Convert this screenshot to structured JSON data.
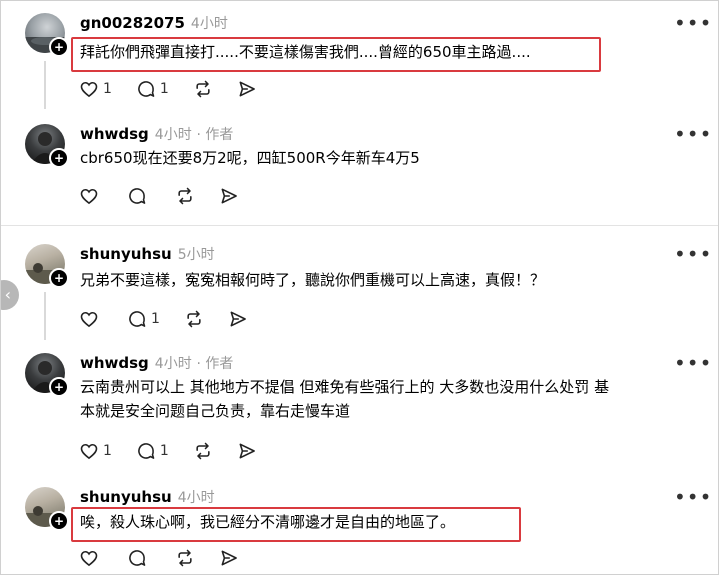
{
  "posts": [
    {
      "username": "gn00282075",
      "time": "4小时",
      "author_tag": "",
      "text_lines": [
        "拜託你們飛彈直接打.....不要這樣傷害我們....曾經的650車主路過...."
      ],
      "likes": "1",
      "replies": "1",
      "highlighted": true
    },
    {
      "username": "whwdsg",
      "time": "4小时",
      "author_tag": "· 作者",
      "text_lines": [
        "cbr650现在还要8万2呢，四缸500R今年新车4万5"
      ],
      "likes": "",
      "replies": "",
      "highlighted": false
    },
    {
      "username": "shunyuhsu",
      "time": "5小时",
      "author_tag": "",
      "text_lines": [
        "兄弟不要這樣，寃寃相報何時了，聽說你們重機可以上高速，真假！？"
      ],
      "likes": "",
      "replies": "1",
      "highlighted": false
    },
    {
      "username": "whwdsg",
      "time": "4小时",
      "author_tag": "· 作者",
      "text_lines": [
        "云南贵州可以上 其他地方不提倡 但难免有些强行上的 大多数也没用什么处罚 基",
        "本就是安全问题自己负责，靠右走慢车道"
      ],
      "likes": "1",
      "replies": "1",
      "highlighted": false
    },
    {
      "username": "shunyuhsu",
      "time": "4小时",
      "author_tag": "",
      "text_lines": [
        "唉，殺人珠心啊，我已經分不清哪邊才是自由的地區了。"
      ],
      "likes": "",
      "replies": "",
      "highlighted": true
    }
  ],
  "icons": {
    "like": "heart-icon",
    "reply": "comment-icon",
    "repost": "repost-icon",
    "share": "send-icon",
    "more": "more-icon",
    "follow": "plus-icon",
    "back": "chevron-left-icon"
  },
  "symbols": {
    "more": "•••",
    "plus": "+",
    "back": "‹"
  },
  "colors": {
    "highlight": "#d93a3f",
    "muted": "#999999",
    "divider": "#e3e3e3"
  }
}
